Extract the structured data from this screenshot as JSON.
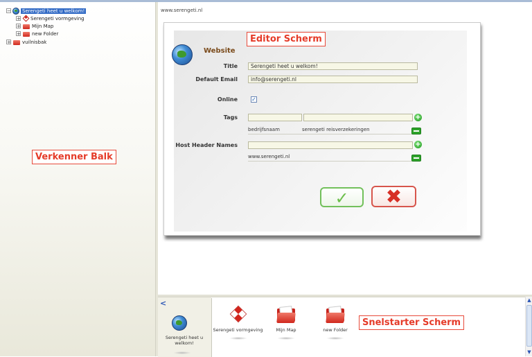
{
  "tree": {
    "items": [
      {
        "label": "Serengeti heet u welkom!",
        "expander": "−",
        "selected": true
      },
      {
        "label": "Serengeti vormgeving",
        "expander": "+"
      },
      {
        "label": "Mijn Map",
        "expander": "+"
      },
      {
        "label": "new Folder",
        "expander": "+"
      },
      {
        "label": "vuilnisbak",
        "expander": "+"
      }
    ]
  },
  "annotations": {
    "tree_panel": "Verkenner Balk",
    "editor": "Editor Scherm",
    "quick_start": "Snelstarter Scherm"
  },
  "editor": {
    "url": "www.serengeti.nl",
    "section_title": "Website",
    "fields": {
      "title_label": "Title",
      "title_value": "Serengeti heet u welkom!",
      "email_label": "Default Email",
      "email_value": "info@serengeti.nl",
      "online_label": "Online",
      "online_checked": "✓",
      "tags_label": "Tags",
      "tag_item_1": "bedrijfsnaam",
      "tag_item_2": "serengeti reisverzekeringen",
      "host_label": "Host Header Names",
      "host_item": "www.serengeti.nl"
    },
    "ok_symbol": "✓",
    "cancel_symbol": "✖"
  },
  "quick_start": {
    "back": "<",
    "tiles": [
      {
        "label": "Serengeti heet u welkom!",
        "icon": "globe-icon"
      },
      {
        "label": "Serengeti vormgeving",
        "icon": "cube-icon"
      },
      {
        "label": "Mijn Map",
        "icon": "folder-icon"
      },
      {
        "label": "new Folder",
        "icon": "folder-icon"
      }
    ],
    "scroll_up": "▲",
    "scroll_down": "▼"
  },
  "colors": {
    "annotation_red": "#e53b29",
    "selection_blue": "#316ac5",
    "accent_green": "#2fa42b"
  }
}
